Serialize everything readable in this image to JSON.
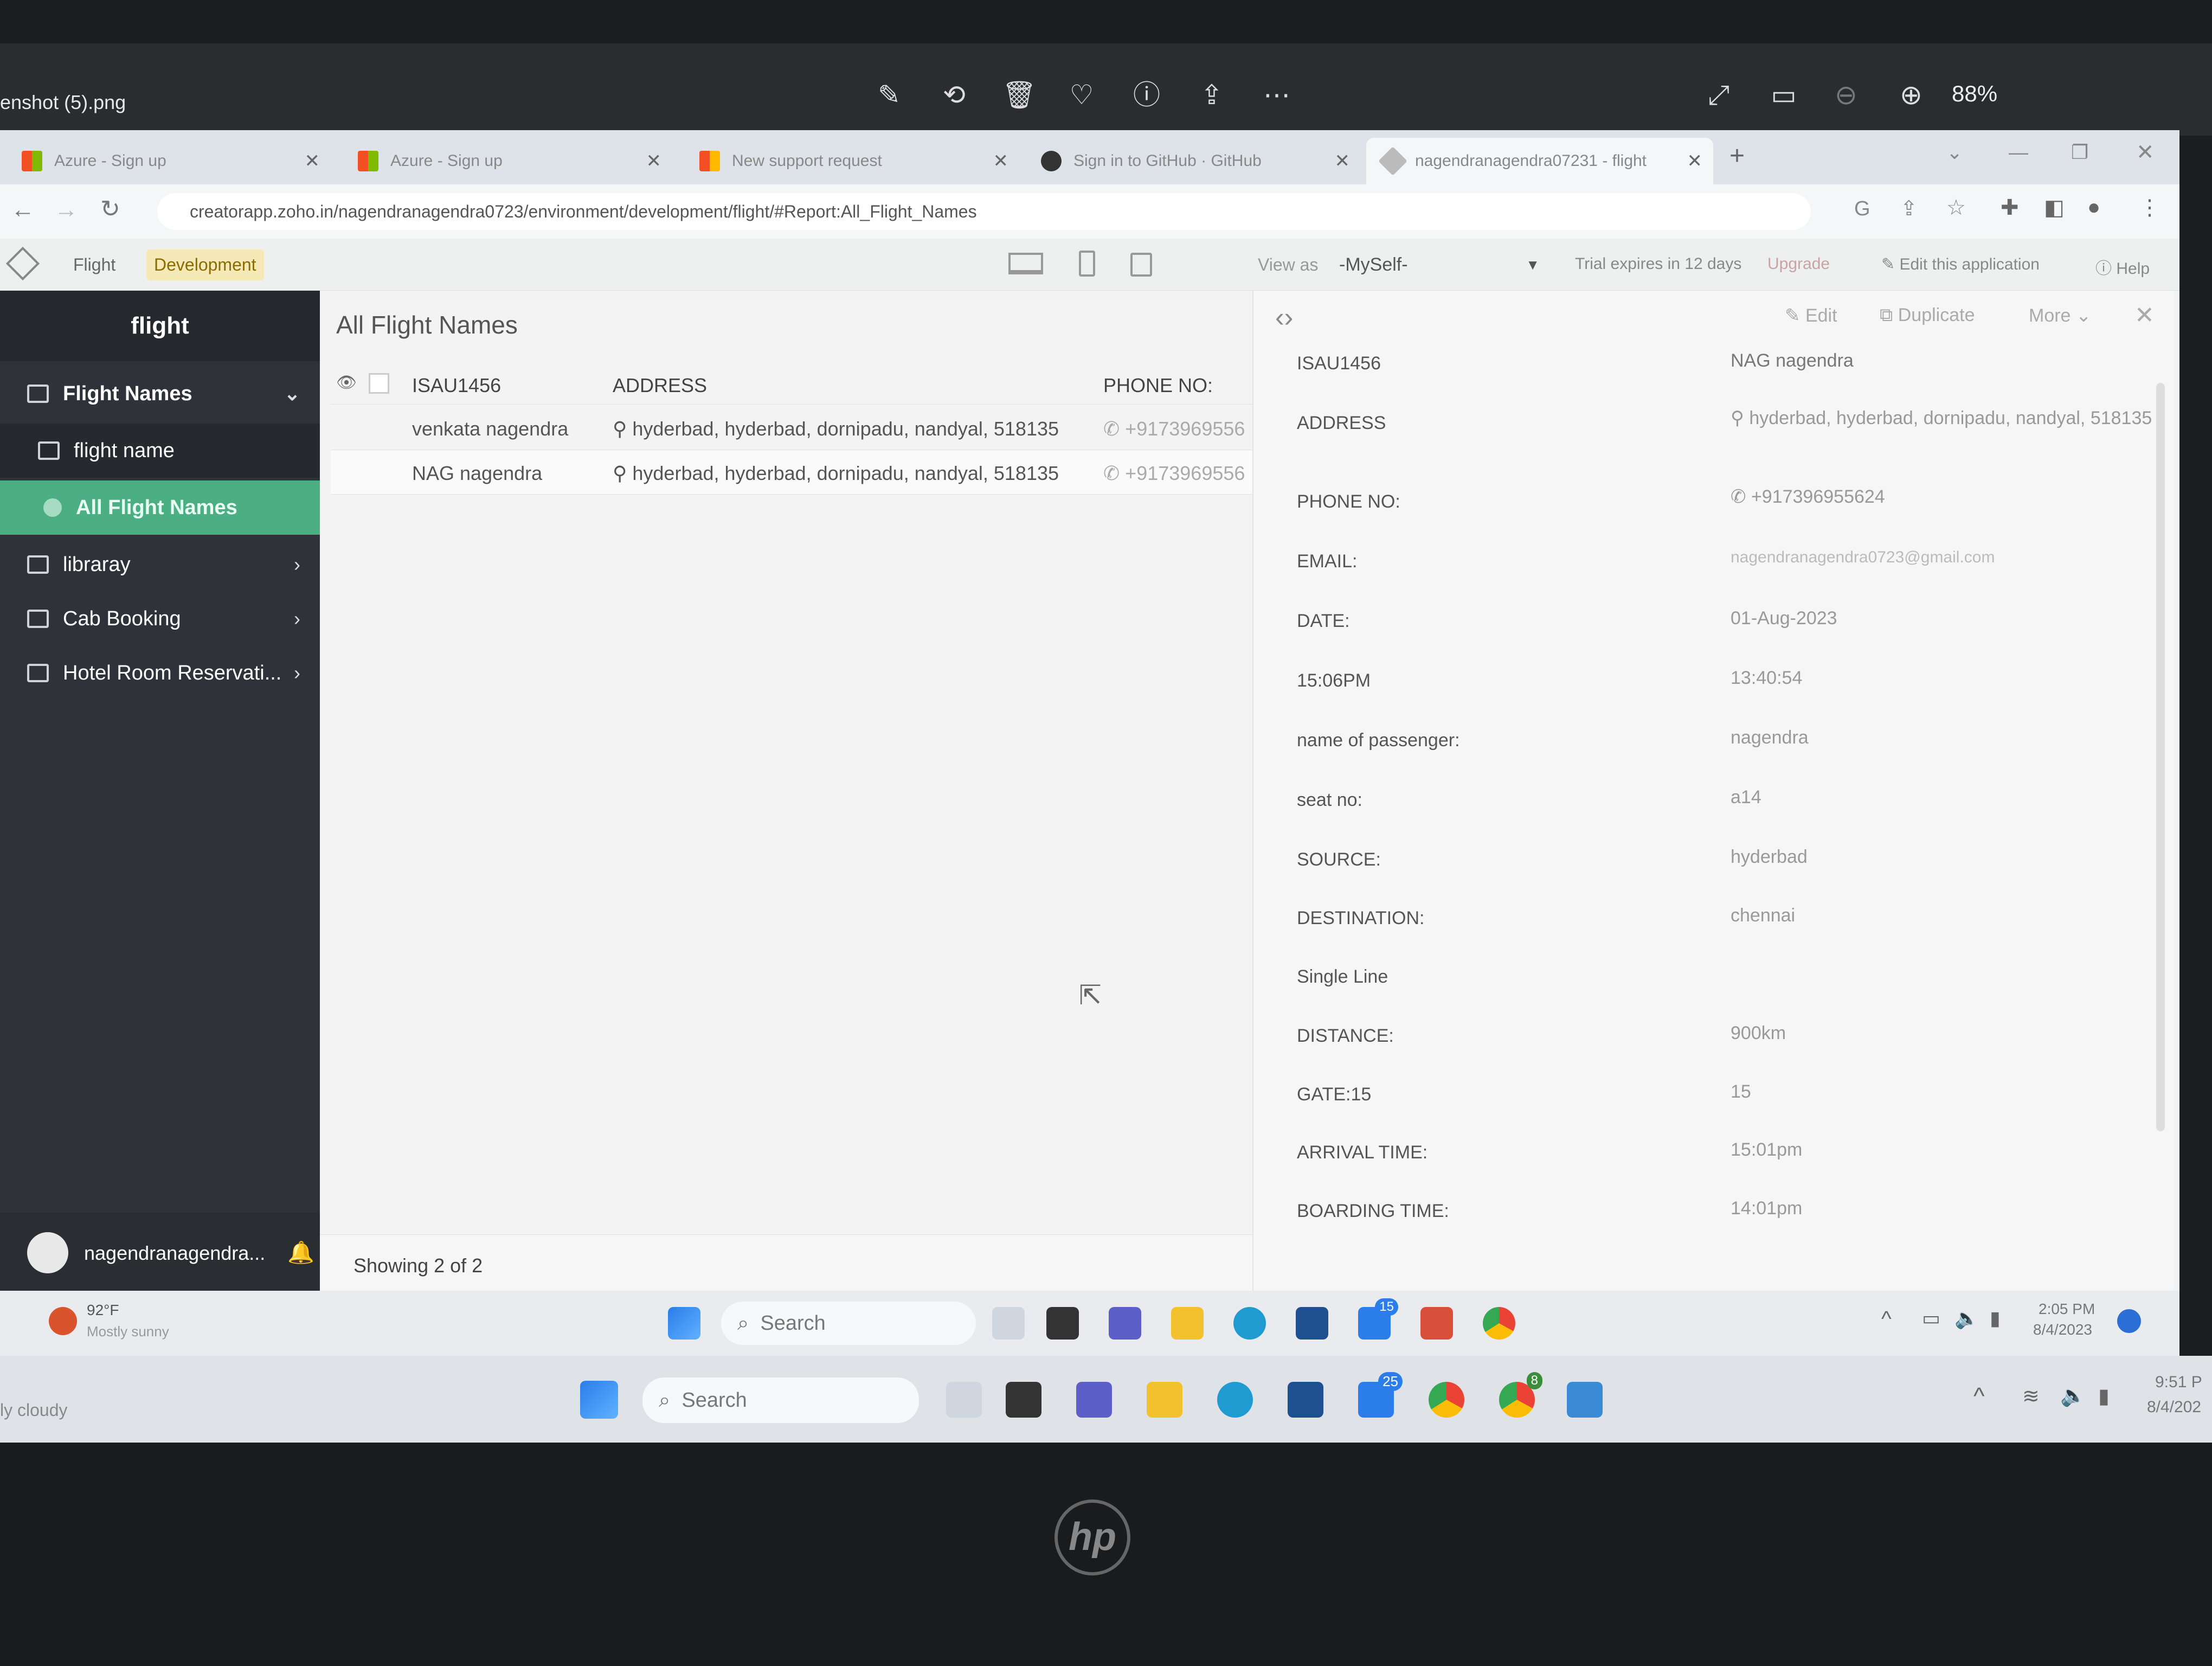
{
  "viewer": {
    "filename": "enshot (5).png",
    "zoom": "88%",
    "icons": [
      "edit-icon",
      "rotate-icon",
      "trash-icon",
      "heart-icon",
      "info-icon",
      "share-icon",
      "more-icon",
      "expand-icon",
      "slideshow-icon",
      "zoom-out-icon",
      "zoom-in-icon"
    ]
  },
  "browser": {
    "tabs": [
      {
        "title": "Azure - Sign up"
      },
      {
        "title": "Azure - Sign up"
      },
      {
        "title": "New support request"
      },
      {
        "title": "Sign in to GitHub · GitHub"
      },
      {
        "title": "nagendranagendra07231 - flight"
      }
    ],
    "new_tab": "+",
    "url": "creatorapp.zoho.in/nagendranagendra0723/environment/development/flight/#Report:All_Flight_Names"
  },
  "app": {
    "breadcrumb": [
      "Flight",
      "Development"
    ],
    "view_as_label": "View as",
    "view_as_value": "-MySelf-",
    "trial_text": "Trial expires in 12 days",
    "upgrade": "Upgrade",
    "edit_app": "Edit this application",
    "help": "Help",
    "title": "flight",
    "sidebar": [
      {
        "label": "Flight Names",
        "level": 0,
        "chevron": "⌄"
      },
      {
        "label": "flight name",
        "level": 1,
        "chevron": ""
      },
      {
        "label": "All Flight Names",
        "level": 1,
        "chevron": "",
        "active": true
      },
      {
        "label": "libraray",
        "level": 0,
        "chevron": "›"
      },
      {
        "label": "Cab Booking",
        "level": 0,
        "chevron": "›"
      },
      {
        "label": "Hotel Room Reservati...",
        "level": 0,
        "chevron": "›"
      }
    ],
    "user": "nagendranagendra...",
    "report_title": "All Flight Names",
    "columns": [
      "ISAU1456",
      "ADDRESS",
      "PHONE NO:"
    ],
    "rows": [
      {
        "name": "venkata nagendra",
        "address": "hyderbad, hyderbad, dornipadu, nandyal, 518135",
        "phone": "+9173969556"
      },
      {
        "name": "NAG nagendra",
        "address": "hyderbad, hyderbad, dornipadu, nandyal, 518135",
        "phone": "+9173969556"
      }
    ],
    "showing": "Showing 2 of 2",
    "detail_actions": {
      "edit": "Edit",
      "duplicate": "Duplicate",
      "more": "More"
    },
    "detail": [
      {
        "label": "ISAU1456",
        "value": "NAG nagendra"
      },
      {
        "label": "ADDRESS",
        "value": "hyderbad, hyderbad, dornipadu, nandyal, 518135"
      },
      {
        "label": "PHONE NO:",
        "value": "+917396955624"
      },
      {
        "label": "EMAIL:",
        "value": "nagendranagendra0723@gmail.com"
      },
      {
        "label": "DATE:",
        "value": "01-Aug-2023"
      },
      {
        "label": "15:06PM",
        "value": "13:40:54"
      },
      {
        "label": "name of passenger:",
        "value": "nagendra"
      },
      {
        "label": "seat no:",
        "value": "a14"
      },
      {
        "label": "SOURCE:",
        "value": "hyderbad"
      },
      {
        "label": "DESTINATION:",
        "value": "chennai"
      },
      {
        "label": "Single Line",
        "value": ""
      },
      {
        "label": "DISTANCE:",
        "value": "900km"
      },
      {
        "label": "GATE:15",
        "value": "15"
      },
      {
        "label": "ARRIVAL TIME:",
        "value": "15:01pm"
      },
      {
        "label": "BOARDING TIME:",
        "value": "14:01pm"
      }
    ]
  },
  "taskbar_inner": {
    "weather_temp": "92°F",
    "weather_desc": "Mostly sunny",
    "search": "Search",
    "time": "2:05 PM",
    "date": "8/4/2023",
    "badge": "15"
  },
  "taskbar_outer": {
    "weather_desc": "ly cloudy",
    "search": "Search",
    "time": "9:51 P",
    "date": "8/4/202",
    "badge": "25",
    "badge2": "8"
  },
  "brand": "hp",
  "colors": {
    "accent_green": "#4caf83",
    "sidebar_bg": "#2f3238",
    "zoho_yellow": "#c8a21f"
  }
}
